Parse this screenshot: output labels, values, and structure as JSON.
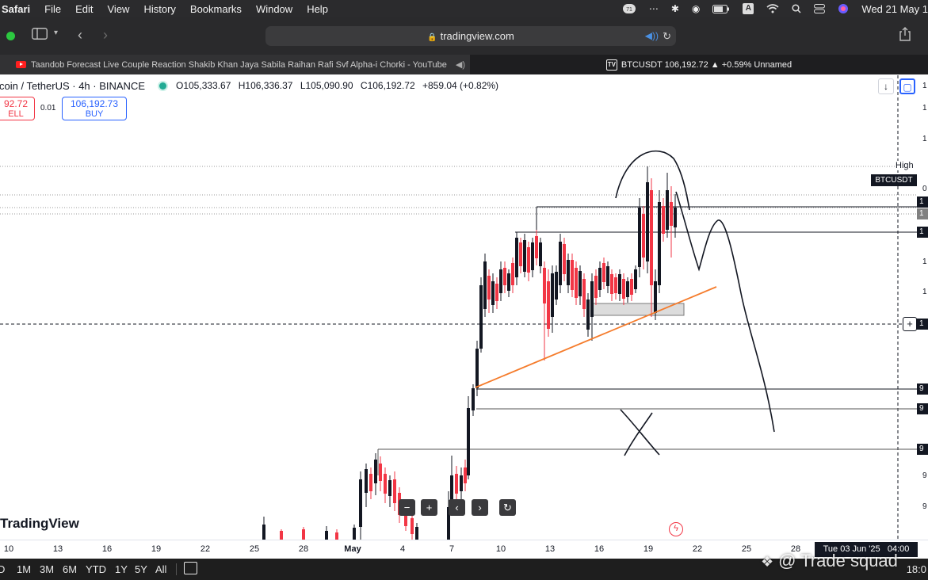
{
  "menubar": {
    "app": "Safari",
    "items": [
      "File",
      "Edit",
      "View",
      "History",
      "Bookmarks",
      "Window",
      "Help"
    ],
    "input_label": "A",
    "clock": "Wed 21 May 1"
  },
  "toolbar": {
    "url": "tradingview.com"
  },
  "tabs": {
    "youtube": "Taandob Forecast Live Couple Reaction Shakib Khan Jaya Sabila Raihan Rafi Svf Alpha-i Chorki - YouTube",
    "tradingview": "BTCUSDT 106,192.72 ▲ +0.59% Unnamed"
  },
  "chart": {
    "symbol_title": "coin / TetherUS · 4h · BINANCE",
    "ohlc": {
      "open": "O105,333.67",
      "high": "H106,336.37",
      "low": "L105,090.90",
      "close": "C106,192.72",
      "change": "+859.04 (+0.82%)"
    },
    "sell": {
      "price": "92.72",
      "label": "ELL"
    },
    "spread": "0.01",
    "buy": {
      "price": "106,192.73",
      "label": "BUY"
    },
    "brand": "TradingView",
    "high_label": "High",
    "symbol_label": "BTCUSDT",
    "price_axis_labels": [
      "1",
      "1",
      "0",
      "1",
      "1",
      "1",
      "1",
      "1",
      "1",
      "1",
      "9",
      "9",
      "9",
      "9",
      "9"
    ],
    "x_ticks": [
      "10",
      "13",
      "16",
      "19",
      "22",
      "25",
      "28",
      "May",
      "4",
      "7",
      "10",
      "13",
      "16",
      "19",
      "22",
      "25",
      "28"
    ],
    "crosshair_date": "Tue 03 Jun '25",
    "crosshair_time": "04:00",
    "colors": {
      "up": "#131722",
      "down": "#f23645",
      "trendline": "#f57c2c",
      "zone": "#d9d9d9"
    }
  },
  "controls": {
    "minus": "−",
    "plus": "+",
    "prev": "‹",
    "next": "›",
    "reset": "↻"
  },
  "bottombar": {
    "ranges": [
      "D",
      "1M",
      "3M",
      "6M",
      "YTD",
      "1Y",
      "5Y",
      "All"
    ],
    "time": "18:0"
  },
  "watermark": "@ Trade squad",
  "chart_data": {
    "type": "candlestick",
    "title": "coin / TetherUS · 4h · BINANCE",
    "x_tick_labels": [
      "10",
      "13",
      "16",
      "19",
      "22",
      "25",
      "28",
      "May",
      "4",
      "7",
      "10",
      "13",
      "16",
      "19",
      "22",
      "25",
      "28"
    ],
    "last_price": 106192.72,
    "ohlc_last": {
      "open": 105333.67,
      "high": 106336.37,
      "low": 105090.9,
      "close": 106192.72
    },
    "change": 859.04,
    "change_pct": 0.82,
    "grid": false
  }
}
